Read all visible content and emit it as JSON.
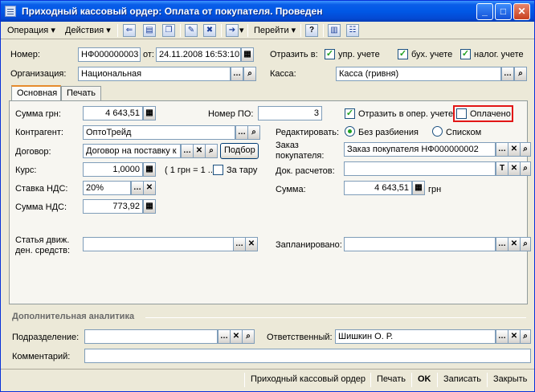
{
  "window": {
    "title": "Приходный кассовый ордер: Оплата от покупателя. Проведен",
    "minimize": "_",
    "maximize": "□",
    "close": "✕"
  },
  "toolbar": {
    "operation_label": "Операция",
    "actions_label": "Действия",
    "goto_label": "Перейти",
    "help_icon_text": "?"
  },
  "header": {
    "number_label": "Номер:",
    "number_value": "НФ000000003",
    "from_label": "от:",
    "date_value": "24.11.2008 16:53:10",
    "reflect_label": "Отразить в:",
    "upr_label": "упр. учете",
    "buh_label": "бух. учете",
    "nalog_label": "налог. учете",
    "org_label": "Организация:",
    "org_value": "Национальная",
    "kassa_label": "Касса:",
    "kassa_value": "Касса (гривня)"
  },
  "tabs": [
    {
      "label": "Основная"
    },
    {
      "label": "Печать"
    }
  ],
  "main": {
    "sum_label": "Сумма грн:",
    "sum_value": "4 643,51",
    "nomer_po_label": "Номер ПО:",
    "nomer_po_value": "3",
    "reflect_oper_label": "Отразить в опер. учете",
    "paid_label": "Оплачено",
    "kontragent_label": "Контрагент:",
    "kontragent_value": "ОптоТрейд",
    "edit_label": "Редактировать:",
    "no_split_label": "Без разбиения",
    "list_label": "Списком",
    "dogovor_label": "Договор:",
    "dogovor_value": "Договор на поставку к",
    "podbor_label": "Подбор",
    "zakaz_label_1": "Заказ",
    "zakaz_label_2": "покупателя:",
    "zakaz_value": "Заказ покупателя НФ000000002",
    "kurs_label": "Курс:",
    "kurs_value": "1,0000",
    "kurs_note": "( 1 грн = 1 ..",
    "za_taru_label": "За тару",
    "dok_rasch_label": "Док. расчетов:",
    "dok_rasch_value": "",
    "stavka_label": "Ставка НДС:",
    "stavka_value": "20%",
    "summa_label": "Сумма:",
    "summa_value": "4 643,51",
    "currency": "грн",
    "summa_nds_label": "Сумма НДС:",
    "summa_nds_value": "773,92",
    "statya_label_1": "Статья движ.",
    "statya_label_2": "ден. средств:",
    "statya_value": "",
    "zaplan_label": "Запланировано:",
    "zaplan_value": ""
  },
  "extra": {
    "group_title": "Дополнительная аналитика",
    "podrazd_label": "Подразделение:",
    "podrazd_value": "",
    "otvetst_label": "Ответственный:",
    "otvetst_value": "Шишкин О. Р.",
    "comment_label": "Комментарий:",
    "comment_value": ""
  },
  "footer": {
    "print_form_label": "Приходный кассовый ордер",
    "print_label": "Печать",
    "ok_label": "OK",
    "save_label": "Записать",
    "close_label": "Закрыть"
  }
}
